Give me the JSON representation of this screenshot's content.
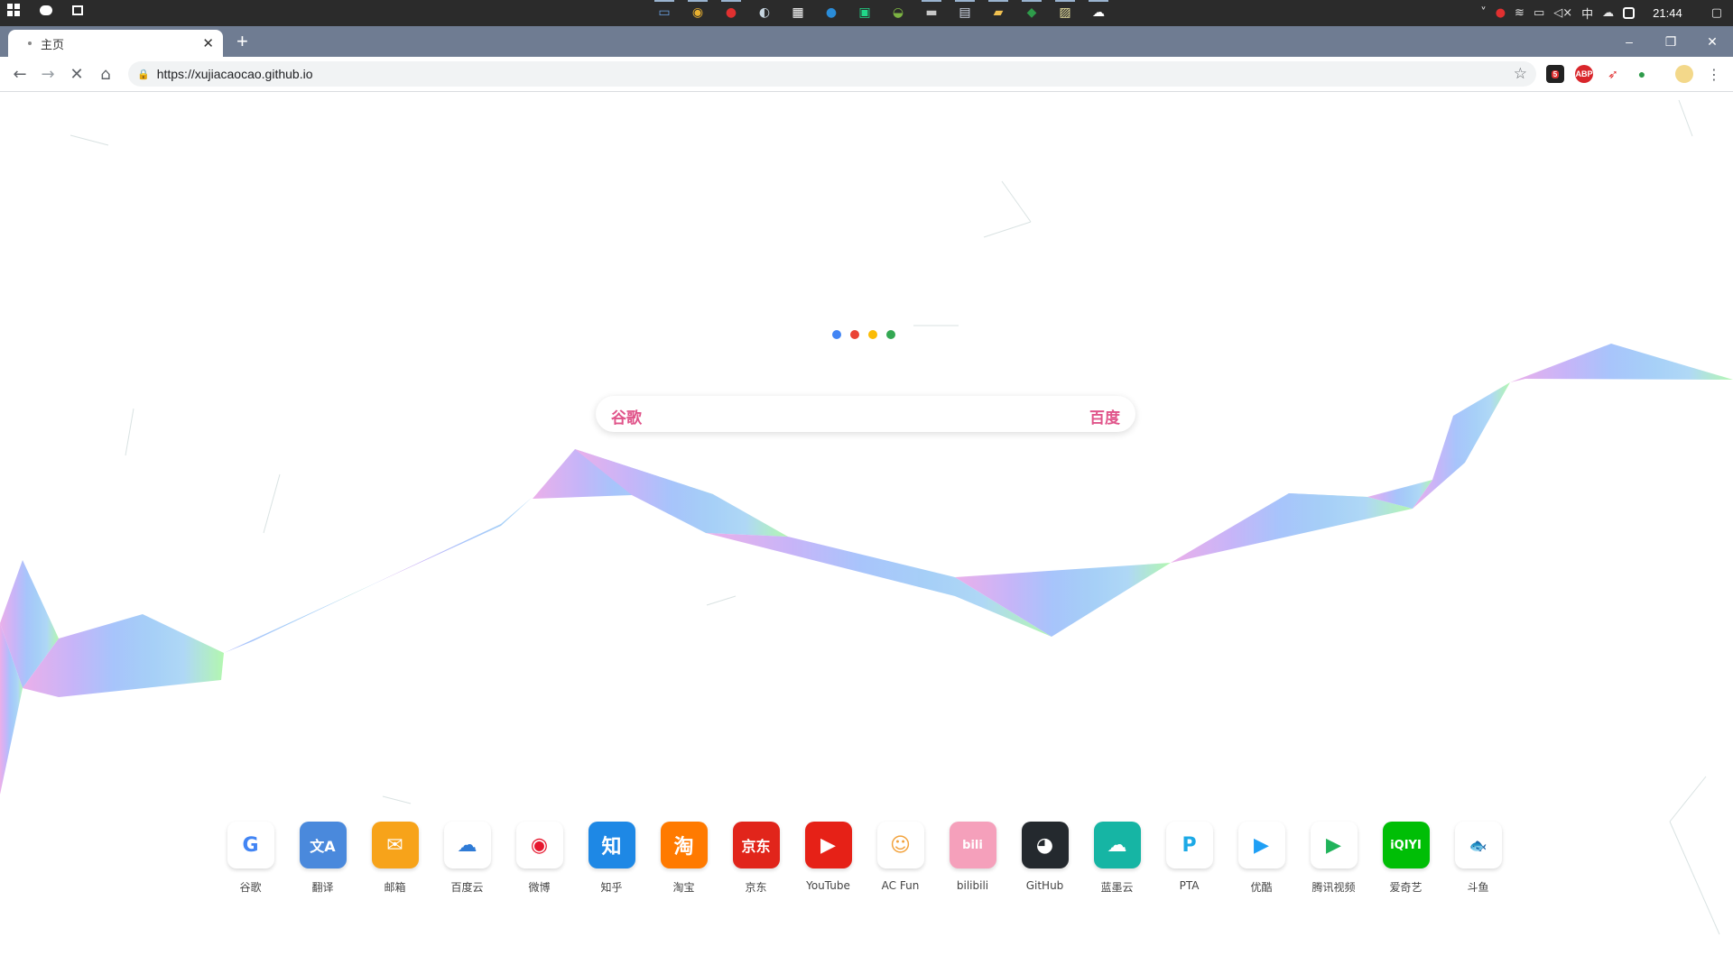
{
  "taskbar": {
    "apps": [
      {
        "icon": "monitor-icon",
        "color": "#6aa0e0",
        "running": true
      },
      {
        "icon": "chrome-icon",
        "color": "#e8b030",
        "running": true
      },
      {
        "icon": "netease-music-icon",
        "color": "#e03030",
        "running": true
      },
      {
        "icon": "steam-icon",
        "color": "#c7d5e0",
        "running": false
      },
      {
        "icon": "calculator-icon",
        "color": "#ffffff",
        "running": false
      },
      {
        "icon": "maxthon-icon",
        "color": "#2a8cd8",
        "running": false
      },
      {
        "icon": "pycharm-icon",
        "color": "#21d789",
        "running": false
      },
      {
        "icon": "android-icon",
        "color": "#7cb342",
        "running": false
      },
      {
        "icon": "terminal-icon",
        "color": "#c8c8c8",
        "running": true
      },
      {
        "icon": "remote-desktop-icon",
        "color": "#d0d8e8",
        "running": true
      },
      {
        "icon": "file-explorer-icon",
        "color": "#f0c050",
        "running": true
      },
      {
        "icon": "green-app-icon",
        "color": "#2e9b4a",
        "running": true
      },
      {
        "icon": "notepad-icon",
        "color": "#e8e0a0",
        "running": true
      },
      {
        "icon": "cloud-app-icon",
        "color": "#ffffff",
        "running": true
      }
    ],
    "clock": "21:44",
    "ime": "中"
  },
  "tab": {
    "title": "主页"
  },
  "toolbar": {
    "url": "https://xujiacaocao.github.io",
    "ext_badge": "5",
    "abp": "ABP"
  },
  "page": {
    "loader_colors": [
      "#4285f4",
      "#ea4335",
      "#fbbc05",
      "#34a853"
    ],
    "search": {
      "left_engine": "谷歌",
      "right_engine": "百度",
      "placeholder": ""
    },
    "sites": [
      {
        "label": "谷歌",
        "glyph": "G",
        "bg": "#ffffff",
        "fg": "#4285f4"
      },
      {
        "label": "翻译",
        "glyph": "文A",
        "bg": "#4a89dc",
        "fg": "#ffffff"
      },
      {
        "label": "邮箱",
        "glyph": "✉",
        "bg": "#f7a31a",
        "fg": "#ffffff"
      },
      {
        "label": "百度云",
        "glyph": "☁",
        "bg": "#ffffff",
        "fg": "#2f7bd6"
      },
      {
        "label": "微博",
        "glyph": "◉",
        "bg": "#ffffff",
        "fg": "#e6162d"
      },
      {
        "label": "知乎",
        "glyph": "知",
        "bg": "#1e88e5",
        "fg": "#ffffff"
      },
      {
        "label": "淘宝",
        "glyph": "淘",
        "bg": "#ff7a00",
        "fg": "#ffffff"
      },
      {
        "label": "京东",
        "glyph": "京东",
        "bg": "#e1251b",
        "fg": "#ffffff"
      },
      {
        "label": "YouTube",
        "glyph": "▶",
        "bg": "#e62117",
        "fg": "#ffffff"
      },
      {
        "label": "AC Fun",
        "glyph": "☺",
        "bg": "#ffffff",
        "fg": "#f2a23c"
      },
      {
        "label": "bilibili",
        "glyph": "bili",
        "bg": "#f5a0bb",
        "fg": "#ffffff"
      },
      {
        "label": "GitHub",
        "glyph": "◕",
        "bg": "#24292e",
        "fg": "#ffffff"
      },
      {
        "label": "蓝墨云",
        "glyph": "☁",
        "bg": "#16b5a4",
        "fg": "#ffffff"
      },
      {
        "label": "PTA",
        "glyph": "P",
        "bg": "#ffffff",
        "fg": "#1ca9e6"
      },
      {
        "label": "优酷",
        "glyph": "▶",
        "bg": "#ffffff",
        "fg": "#1f9ff5"
      },
      {
        "label": "腾讯视频",
        "glyph": "▶",
        "bg": "#ffffff",
        "fg": "#20b35a"
      },
      {
        "label": "爱奇艺",
        "glyph": "iQIYI",
        "bg": "#00be06",
        "fg": "#ffffff"
      },
      {
        "label": "斗鱼",
        "glyph": "🐟",
        "bg": "#ffffff",
        "fg": "#f27d20"
      }
    ]
  }
}
